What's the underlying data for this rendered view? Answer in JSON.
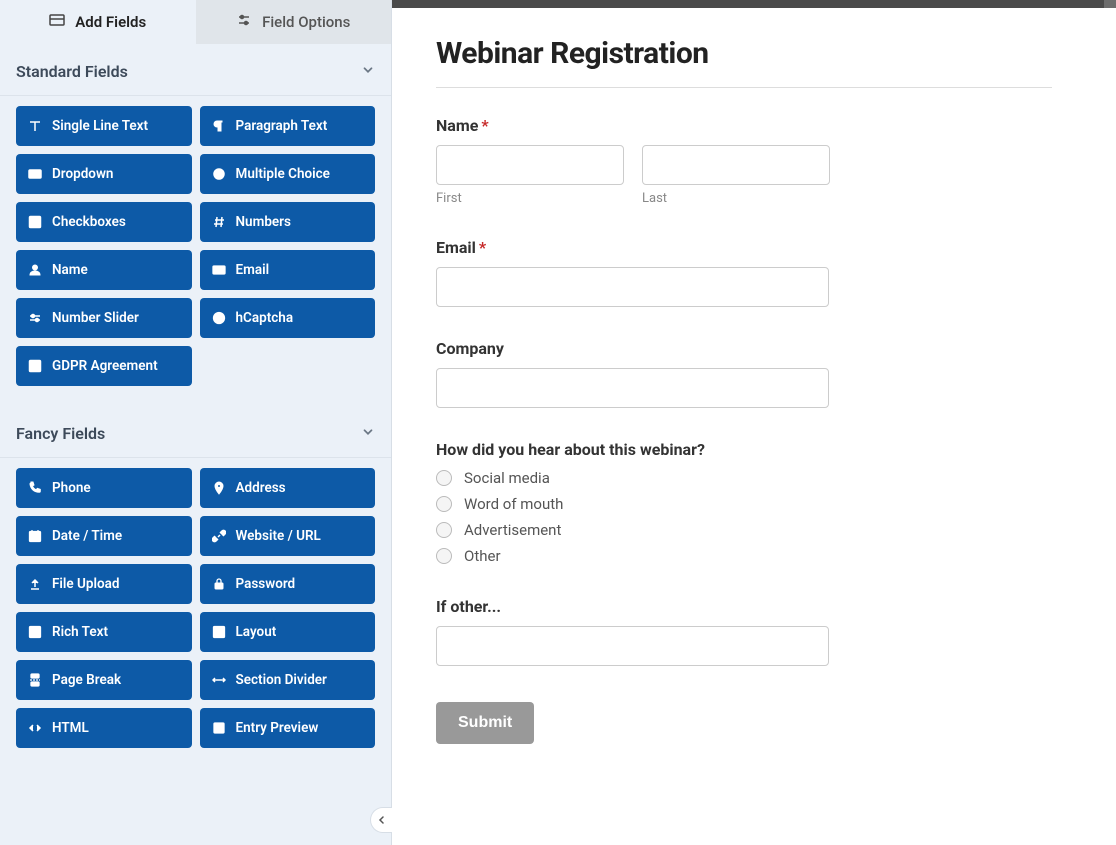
{
  "tabs": {
    "add_fields": "Add Fields",
    "field_options": "Field Options"
  },
  "sections": {
    "standard_label": "Standard Fields",
    "fancy_label": "Fancy Fields"
  },
  "standard_fields": {
    "single_line_text": "Single Line Text",
    "paragraph_text": "Paragraph Text",
    "dropdown": "Dropdown",
    "multiple_choice": "Multiple Choice",
    "checkboxes": "Checkboxes",
    "numbers": "Numbers",
    "name": "Name",
    "email": "Email",
    "number_slider": "Number Slider",
    "hcaptcha": "hCaptcha",
    "gdpr_agreement": "GDPR Agreement"
  },
  "fancy_fields": {
    "phone": "Phone",
    "address": "Address",
    "date_time": "Date / Time",
    "website_url": "Website / URL",
    "file_upload": "File Upload",
    "password": "Password",
    "rich_text": "Rich Text",
    "layout": "Layout",
    "page_break": "Page Break",
    "section_divider": "Section Divider",
    "html": "HTML",
    "entry_preview": "Entry Preview"
  },
  "form": {
    "title": "Webinar Registration",
    "name_label": "Name",
    "first_label": "First",
    "last_label": "Last",
    "email_label": "Email",
    "company_label": "Company",
    "hear_label": "How did you hear about this webinar?",
    "hear_options": {
      "o1": "Social media",
      "o2": "Word of mouth",
      "o3": "Advertisement",
      "o4": "Other"
    },
    "other_label": "If other...",
    "submit_label": "Submit"
  }
}
